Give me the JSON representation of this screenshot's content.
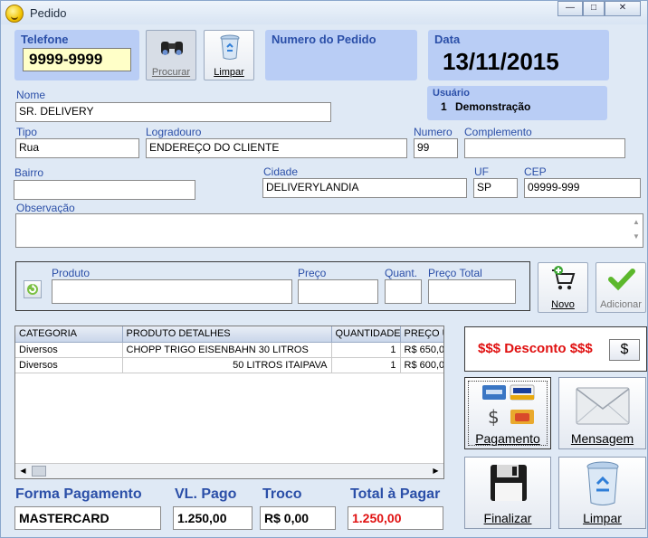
{
  "window": {
    "title": "Pedido"
  },
  "telefone": {
    "label": "Telefone",
    "value": "9999-9999"
  },
  "toolbar": {
    "procurar_label": "Procurar",
    "limpar_label": "Limpar"
  },
  "numero_pedido": {
    "label": "Numero do Pedido"
  },
  "data": {
    "label": "Data",
    "value": "13/11/2015"
  },
  "usuario": {
    "label": "Usuário",
    "id": "1",
    "name": "Demonstração"
  },
  "nome": {
    "label": "Nome",
    "value": "SR. DELIVERY"
  },
  "tipo": {
    "label": "Tipo",
    "value": "Rua"
  },
  "logradouro": {
    "label": "Logradouro",
    "value": "ENDEREÇO DO CLIENTE"
  },
  "numero": {
    "label": "Numero",
    "value": "99"
  },
  "complemento": {
    "label": "Complemento",
    "value": ""
  },
  "bairro": {
    "label": "Bairro",
    "value": ""
  },
  "cidade": {
    "label": "Cidade",
    "value": "DELIVERYLANDIA"
  },
  "uf": {
    "label": "UF",
    "value": "SP"
  },
  "cep": {
    "label": "CEP",
    "value": "09999-999"
  },
  "observacao": {
    "label": "Observação",
    "value": ""
  },
  "produto_entry": {
    "produto_label": "Produto",
    "preco_label": "Preço",
    "quant_label": "Quant.",
    "preco_total_label": "Preço Total",
    "novo_label": "Novo",
    "adicionar_label": "Adicionar"
  },
  "grid": {
    "columns": [
      "CATEGORIA",
      "PRODUTO DETALHES",
      "QUANTIDADE",
      "PREÇO U"
    ],
    "rows": [
      [
        "Diversos",
        "CHOPP TRIGO EISENBAHN 30 LITROS",
        "1",
        "R$ 650,0"
      ],
      [
        "Diversos",
        "50 LITROS ITAIPAVA",
        "1",
        "R$ 600,0"
      ]
    ]
  },
  "desconto": {
    "label": "$$$ Desconto $$$",
    "button": "$"
  },
  "actions": {
    "pagamento": "Pagamento",
    "mensagem": "Mensagem",
    "finalizar": "Finalizar",
    "limpar": "Limpar"
  },
  "totals": {
    "forma_label": "Forma Pagamento",
    "forma_value": "MASTERCARD",
    "pago_label": "VL. Pago",
    "pago_value": "1.250,00",
    "troco_label": "Troco",
    "troco_value": "R$ 0,00",
    "total_label": "Total à Pagar",
    "total_value": "1.250,00"
  },
  "colors": {
    "accent": "#2b4fa8",
    "panel": "#b9cdf5",
    "danger": "#e01010"
  }
}
